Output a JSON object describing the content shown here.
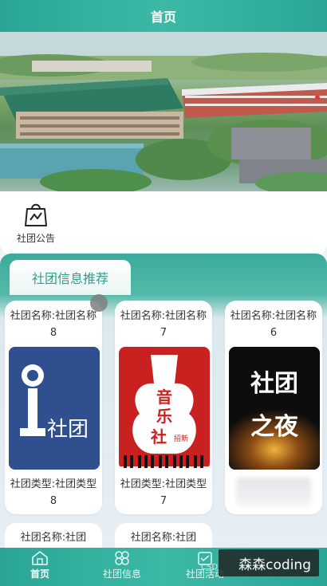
{
  "header": {
    "title": "首页"
  },
  "notice": {
    "label": "社团公告",
    "icon": "bag-announcement-icon"
  },
  "recommend": {
    "tab_label": "社团信息推荐",
    "cards": [
      {
        "name": "社团名称:社团名称8",
        "type": "社团类型:社团类型8",
        "image_text": "社团"
      },
      {
        "name": "社团名称:社团名称7",
        "type": "社团类型:社团类型7",
        "image_text_1": "音",
        "image_text_2": "乐",
        "image_text_3": "社",
        "image_badge": "招新"
      },
      {
        "name": "社团名称:社团名称6",
        "image_text_top": "社团",
        "image_text_bottom": "之夜"
      }
    ],
    "next_row": [
      {
        "name": "社团名称:社团"
      },
      {
        "name": "社团名称:社团"
      }
    ]
  },
  "tabbar": {
    "tabs": [
      {
        "label": "首页",
        "icon": "home-icon",
        "active": true
      },
      {
        "label": "社团信息",
        "icon": "clover-icon",
        "active": false
      },
      {
        "label": "社团活动",
        "icon": "activity-icon",
        "active": false
      }
    ]
  },
  "watermark": {
    "prefix": "CSD",
    "text": "森森coding"
  }
}
